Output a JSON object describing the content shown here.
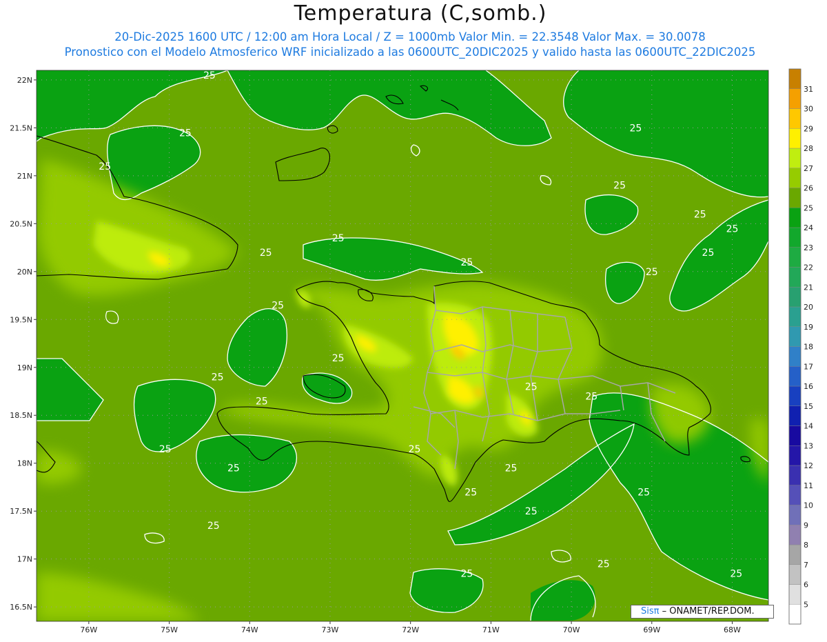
{
  "title": "Temperatura (C,somb.)",
  "subtitle_line1": "20-Dic-2025 1600 UTC / 12:00 am Hora Local / Z = 1000mb  Valor Min. = 22.3548  Valor Max. = 30.0078",
  "subtitle_line2": "Pronostico con el Modelo Atmosferico WRF inicializado a las 0600UTC_20DIC2025 y valido hasta las  0600UTC_22DIC2025",
  "subtitle_color": "#1e7be0",
  "credit": {
    "logo_text": "Sisπ",
    "text": "– ONAMET/REP.DOM."
  },
  "axes": {
    "lat_labels": [
      "22N",
      "21.5N",
      "21N",
      "20.5N",
      "20N",
      "19.5N",
      "19N",
      "18.5N",
      "18N",
      "17.5N",
      "17N",
      "16.5N"
    ],
    "lon_labels": [
      "76W",
      "75W",
      "74W",
      "73W",
      "72W",
      "71W",
      "70W",
      "69W",
      "68W"
    ]
  },
  "map_data": {
    "type": "heatmap",
    "extent": {
      "lon_min": -76.65,
      "lon_max": -67.55,
      "lat_min": 16.35,
      "lat_max": 22.1
    },
    "lats": [
      22,
      21.5,
      21,
      20.5,
      20,
      19.5,
      19,
      18.5,
      18,
      17.5,
      17,
      16.5
    ],
    "lons": [
      -76,
      -75,
      -74,
      -73,
      -72,
      -71,
      -70,
      -69,
      -68
    ],
    "grid": true,
    "contour_value": 25,
    "contour_labels": [
      {
        "lon": -74.5,
        "lat": 22.05,
        "text": "25"
      },
      {
        "lon": -74.8,
        "lat": 21.45,
        "text": "25"
      },
      {
        "lon": -75.8,
        "lat": 21.1,
        "text": "25"
      },
      {
        "lon": -72.9,
        "lat": 20.35,
        "text": "25"
      },
      {
        "lon": -73.8,
        "lat": 20.2,
        "text": "25"
      },
      {
        "lon": -71.3,
        "lat": 20.1,
        "text": "25"
      },
      {
        "lon": -69.4,
        "lat": 20.9,
        "text": "25"
      },
      {
        "lon": -68.4,
        "lat": 20.6,
        "text": "25"
      },
      {
        "lon": -68,
        "lat": 20.45,
        "text": "25"
      },
      {
        "lon": -68.3,
        "lat": 20.2,
        "text": "25"
      },
      {
        "lon": -69.0,
        "lat": 20.0,
        "text": "25"
      },
      {
        "lon": -69.2,
        "lat": 21.5,
        "text": "25"
      },
      {
        "lon": -73.65,
        "lat": 19.65,
        "text": "25"
      },
      {
        "lon": -72.9,
        "lat": 19.1,
        "text": "25"
      },
      {
        "lon": -74.4,
        "lat": 18.9,
        "text": "25"
      },
      {
        "lon": -73.85,
        "lat": 18.65,
        "text": "25"
      },
      {
        "lon": -75.05,
        "lat": 18.15,
        "text": "25"
      },
      {
        "lon": -74.2,
        "lat": 17.95,
        "text": "25"
      },
      {
        "lon": -71.95,
        "lat": 18.15,
        "text": "25"
      },
      {
        "lon": -70.5,
        "lat": 18.8,
        "text": "25"
      },
      {
        "lon": -69.75,
        "lat": 18.7,
        "text": "25"
      },
      {
        "lon": -70.75,
        "lat": 17.95,
        "text": "25"
      },
      {
        "lon": -71.25,
        "lat": 17.7,
        "text": "25"
      },
      {
        "lon": -70.5,
        "lat": 17.5,
        "text": "25"
      },
      {
        "lon": -69.1,
        "lat": 17.7,
        "text": "25"
      },
      {
        "lon": -74.45,
        "lat": 17.35,
        "text": "25"
      },
      {
        "lon": -69.6,
        "lat": 16.95,
        "text": "25"
      },
      {
        "lon": -71.3,
        "lat": 16.85,
        "text": "25"
      },
      {
        "lon": -67.95,
        "lat": 16.85,
        "text": "25"
      }
    ],
    "colorbar": {
      "levels": [
        5,
        6,
        7,
        8,
        9,
        10,
        11,
        12,
        13,
        14,
        15,
        16,
        17,
        18,
        19,
        20,
        21,
        22,
        23,
        24,
        25,
        26,
        27,
        28,
        29,
        30,
        31
      ],
      "colors": [
        "#ffffff",
        "#e0e0e0",
        "#c2c2c2",
        "#a6a6a6",
        "#9080b0",
        "#7070b8",
        "#5550b8",
        "#3a30b0",
        "#2416a8",
        "#180aa0",
        "#1020b0",
        "#1840c0",
        "#2560c8",
        "#3080c8",
        "#3099b0",
        "#2aa090",
        "#28a070",
        "#22a858",
        "#1eab42",
        "#12a82c",
        "#0aa212",
        "#6aa800",
        "#96cc00",
        "#c0ee10",
        "#fff000",
        "#ffc800",
        "#f5a000",
        "#c88000"
      ]
    }
  }
}
